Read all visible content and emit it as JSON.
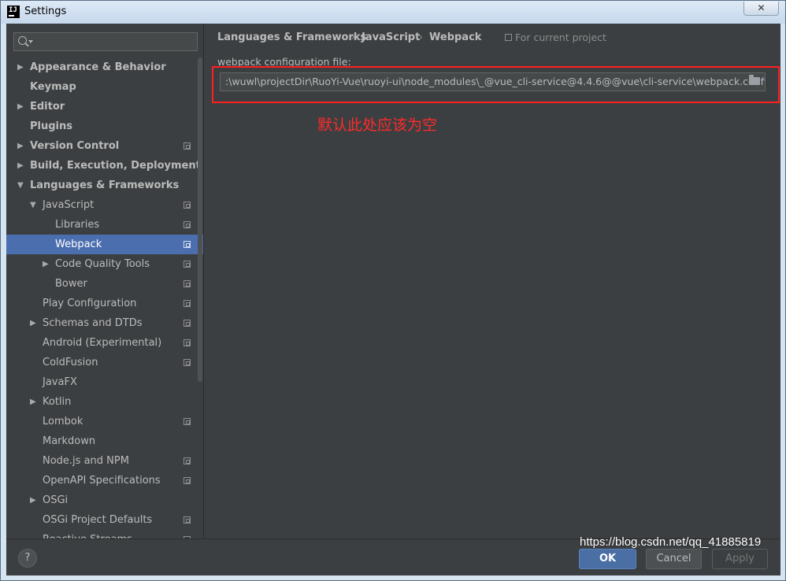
{
  "window": {
    "title": "Settings",
    "close_glyph": "✕"
  },
  "sidebar": {
    "search_placeholder": "",
    "items": [
      {
        "label": "Appearance & Behavior",
        "level": 0,
        "arrow": "▶",
        "bold": true,
        "shared": false
      },
      {
        "label": "Keymap",
        "level": 0,
        "arrow": "",
        "bold": true,
        "shared": false
      },
      {
        "label": "Editor",
        "level": 0,
        "arrow": "▶",
        "bold": true,
        "shared": false
      },
      {
        "label": "Plugins",
        "level": 0,
        "arrow": "",
        "bold": true,
        "shared": false
      },
      {
        "label": "Version Control",
        "level": 0,
        "arrow": "▶",
        "bold": true,
        "shared": true
      },
      {
        "label": "Build, Execution, Deployment",
        "level": 0,
        "arrow": "▶",
        "bold": true,
        "shared": false
      },
      {
        "label": "Languages & Frameworks",
        "level": 0,
        "arrow": "▼",
        "bold": true,
        "shared": false
      },
      {
        "label": "JavaScript",
        "level": 1,
        "arrow": "▼",
        "bold": false,
        "shared": true
      },
      {
        "label": "Libraries",
        "level": 2,
        "arrow": "",
        "bold": false,
        "shared": true
      },
      {
        "label": "Webpack",
        "level": 2,
        "arrow": "",
        "bold": false,
        "shared": true,
        "selected": true
      },
      {
        "label": "Code Quality Tools",
        "level": 2,
        "arrow": "▶",
        "bold": false,
        "shared": true
      },
      {
        "label": "Bower",
        "level": 2,
        "arrow": "",
        "bold": false,
        "shared": true
      },
      {
        "label": "Play Configuration",
        "level": 1,
        "arrow": "",
        "bold": false,
        "shared": true
      },
      {
        "label": "Schemas and DTDs",
        "level": 1,
        "arrow": "▶",
        "bold": false,
        "shared": true
      },
      {
        "label": "Android (Experimental)",
        "level": 1,
        "arrow": "",
        "bold": false,
        "shared": true
      },
      {
        "label": "ColdFusion",
        "level": 1,
        "arrow": "",
        "bold": false,
        "shared": true
      },
      {
        "label": "JavaFX",
        "level": 1,
        "arrow": "",
        "bold": false,
        "shared": false
      },
      {
        "label": "Kotlin",
        "level": 1,
        "arrow": "▶",
        "bold": false,
        "shared": false
      },
      {
        "label": "Lombok",
        "level": 1,
        "arrow": "",
        "bold": false,
        "shared": true
      },
      {
        "label": "Markdown",
        "level": 1,
        "arrow": "",
        "bold": false,
        "shared": false
      },
      {
        "label": "Node.js and NPM",
        "level": 1,
        "arrow": "",
        "bold": false,
        "shared": true
      },
      {
        "label": "OpenAPI Specifications",
        "level": 1,
        "arrow": "",
        "bold": false,
        "shared": true
      },
      {
        "label": "OSGi",
        "level": 1,
        "arrow": "▶",
        "bold": false,
        "shared": false
      },
      {
        "label": "OSGi Project Defaults",
        "level": 1,
        "arrow": "",
        "bold": false,
        "shared": true
      },
      {
        "label": "Reactive Streams",
        "level": 1,
        "arrow": "",
        "bold": false,
        "shared": true
      }
    ]
  },
  "breadcrumb": {
    "items": [
      "Languages & Frameworks",
      "JavaScript",
      "Webpack"
    ],
    "separator": "›",
    "scope": "For current project"
  },
  "form": {
    "field_label": "webpack configuration file:",
    "path_value": ":\\wuwl\\projectDir\\RuoYi-Vue\\ruoyi-ui\\node_modules\\_@vue_cli-service@4.4.6@@vue\\cli-service\\webpack.config.js",
    "annotation": "默认此处应该为空"
  },
  "footer": {
    "help_label": "?",
    "ok_label": "OK",
    "cancel_label": "Cancel",
    "apply_label": "Apply"
  },
  "watermark": "https://blog.csdn.net/qq_41885819",
  "colors": {
    "selection": "#4b6eaf",
    "background": "#3c3f41",
    "annotation": "#ff2a2a"
  }
}
